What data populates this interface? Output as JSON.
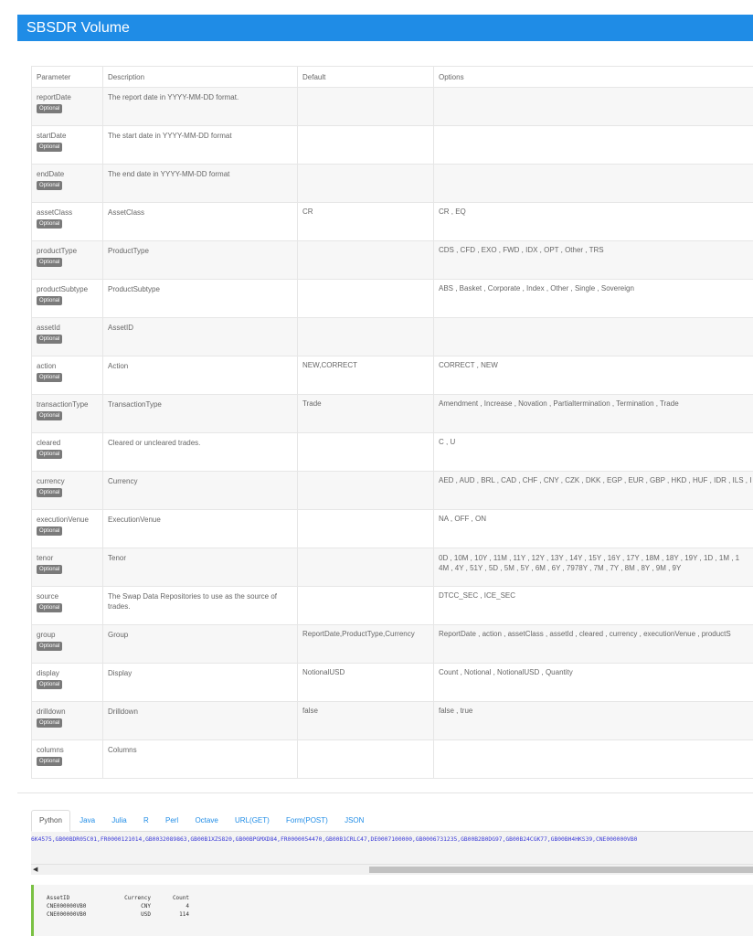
{
  "header": {
    "title": "SBSDR Volume"
  },
  "table": {
    "columns": [
      "Parameter",
      "Description",
      "Default",
      "Options"
    ],
    "badge_label": "Optional",
    "rows": [
      {
        "name": "reportDate",
        "description": "The report date in YYYY-MM-DD format.",
        "default": "",
        "options": ""
      },
      {
        "name": "startDate",
        "description": "The start date in YYYY-MM-DD format",
        "default": "",
        "options": ""
      },
      {
        "name": "endDate",
        "description": "The end date in YYYY-MM-DD format",
        "default": "",
        "options": ""
      },
      {
        "name": "assetClass",
        "description": "AssetClass",
        "default": "CR",
        "options": "CR , EQ"
      },
      {
        "name": "productType",
        "description": "ProductType",
        "default": "",
        "options": "CDS , CFD , EXO , FWD , IDX , OPT , Other , TRS"
      },
      {
        "name": "productSubtype",
        "description": "ProductSubtype",
        "default": "",
        "options": "ABS , Basket , Corporate , Index , Other , Single , Sovereign"
      },
      {
        "name": "assetId",
        "description": "AssetID",
        "default": "",
        "options": ""
      },
      {
        "name": "action",
        "description": "Action",
        "default": "NEW,CORRECT",
        "options": "CORRECT , NEW"
      },
      {
        "name": "transactionType",
        "description": "TransactionType",
        "default": "Trade",
        "options": "Amendment , Increase , Novation , Partialtermination , Termination , Trade"
      },
      {
        "name": "cleared",
        "description": "Cleared or uncleared trades.",
        "default": "",
        "options": "C , U"
      },
      {
        "name": "currency",
        "description": "Currency",
        "default": "",
        "options": "AED , AUD , BRL , CAD , CHF , CNY , CZK , DKK , EGP , EUR , GBP , HKD , HUF , IDR , ILS , I"
      },
      {
        "name": "executionVenue",
        "description": "ExecutionVenue",
        "default": "",
        "options": "NA , OFF , ON"
      },
      {
        "name": "tenor",
        "description": "Tenor",
        "default": "",
        "options": "0D , 10M , 10Y , 11M , 11Y , 12Y , 13Y , 14Y , 15Y , 16Y , 17Y , 18M , 18Y , 19Y , 1D , 1M , 1\n4M , 4Y , 51Y , 5D , 5M , 5Y , 6M , 6Y , 7978Y , 7M , 7Y , 8M , 8Y , 9M , 9Y"
      },
      {
        "name": "source",
        "description": "The Swap Data Repositories to use as the source of trades.",
        "default": "",
        "options": "DTCC_SEC , ICE_SEC"
      },
      {
        "name": "group",
        "description": "Group",
        "default": "ReportDate,ProductType,Currency",
        "options": "ReportDate , action , assetClass , assetId , cleared , currency , executionVenue , productS"
      },
      {
        "name": "display",
        "description": "Display",
        "default": "NotionalUSD",
        "options": "Count , Notional , NotionalUSD , Quantity"
      },
      {
        "name": "drilldown",
        "description": "Drilldown",
        "default": "false",
        "options": "false , true"
      },
      {
        "name": "columns",
        "description": "Columns",
        "default": "",
        "options": ""
      }
    ]
  },
  "tabs": [
    "Python",
    "Java",
    "Julia",
    "R",
    "Perl",
    "Octave",
    "URL(GET)",
    "Form(POST)",
    "JSON"
  ],
  "active_tab": "Python",
  "code": {
    "line": "6K4575,GB00BDR05C01,FR0000121014,GB0032089863,GB00B1XZS820,GB00BPGMXD84,FR0000054470,GB00B1CRLC47,DE0007100000,GB0006731235,GB00B2B0DG97,GB00B24CGK77,GB00BH4HKS39,CNE000000VB0"
  },
  "output": {
    "headers": [
      "AssetID",
      "Currency",
      "Count"
    ],
    "rows": [
      [
        "CNE000000VB0",
        "CNY",
        "4"
      ],
      [
        "CNE000000VB0",
        "USD",
        "114"
      ]
    ]
  },
  "colors": {
    "accent": "#1f8ce6",
    "output_border": "#7ac143",
    "badge": "#7a7a7a"
  }
}
